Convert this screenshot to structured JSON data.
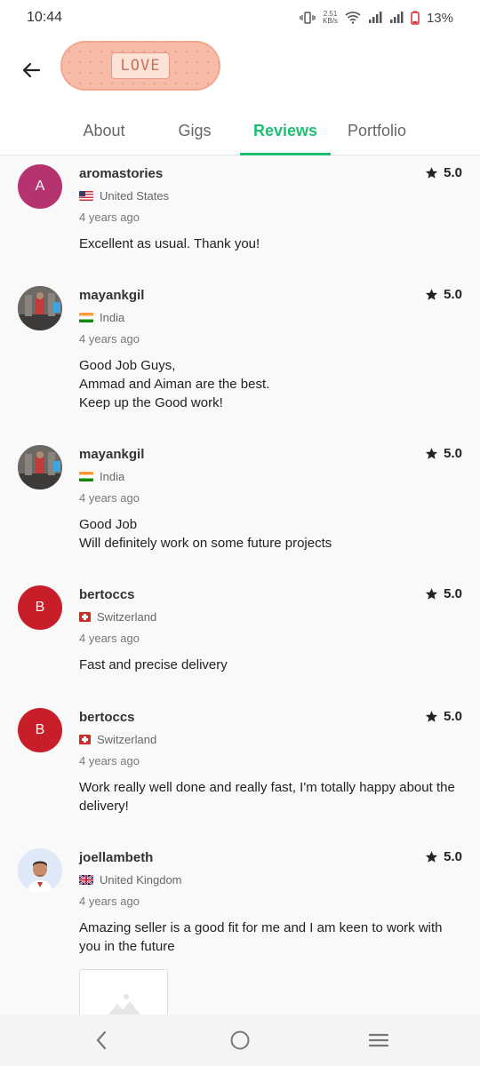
{
  "status_bar": {
    "time": "10:44",
    "net_speed": "2.51",
    "net_unit": "KB/s",
    "battery": "13%"
  },
  "header": {
    "back_icon": "arrow-left-icon",
    "sticker_text": "LOVE"
  },
  "tabs": [
    {
      "label": "About",
      "active": false
    },
    {
      "label": "Gigs",
      "active": false
    },
    {
      "label": "Reviews",
      "active": true
    },
    {
      "label": "Portfolio",
      "active": false
    }
  ],
  "colors": {
    "accent": "#1dbf73",
    "avatar_a": "#b5336e",
    "avatar_b": "#c81e2a"
  },
  "reviews": [
    {
      "username": "aromastories",
      "avatar_letter": "A",
      "country": "United States",
      "time": "4 years ago",
      "rating": "5.0",
      "text": "Excellent as usual. Thank you!"
    },
    {
      "username": "mayankgil",
      "avatar_letter": "",
      "country": "India",
      "time": "4 years ago",
      "rating": "5.0",
      "text": "Good Job Guys,\nAmmad and Aiman are the best.\nKeep up the Good work!"
    },
    {
      "username": "mayankgil",
      "avatar_letter": "",
      "country": "India",
      "time": "4 years ago",
      "rating": "5.0",
      "text": "Good Job\nWill definitely work on some future projects"
    },
    {
      "username": "bertoccs",
      "avatar_letter": "B",
      "country": "Switzerland",
      "time": "4 years ago",
      "rating": "5.0",
      "text": "Fast and precise delivery"
    },
    {
      "username": "bertoccs",
      "avatar_letter": "B",
      "country": "Switzerland",
      "time": "4 years ago",
      "rating": "5.0",
      "text": "Work really well done and really fast, I'm totally happy about the delivery!"
    },
    {
      "username": "joellambeth",
      "avatar_letter": "",
      "country": "United Kingdom",
      "time": "4 years ago",
      "rating": "5.0",
      "text": "Amazing seller is a good fit for me and I am keen to work with you in the future"
    }
  ],
  "nav": {
    "back_icon": "chevron-left-icon",
    "home_icon": "circle-home-icon",
    "menu_icon": "menu-lines-icon"
  }
}
